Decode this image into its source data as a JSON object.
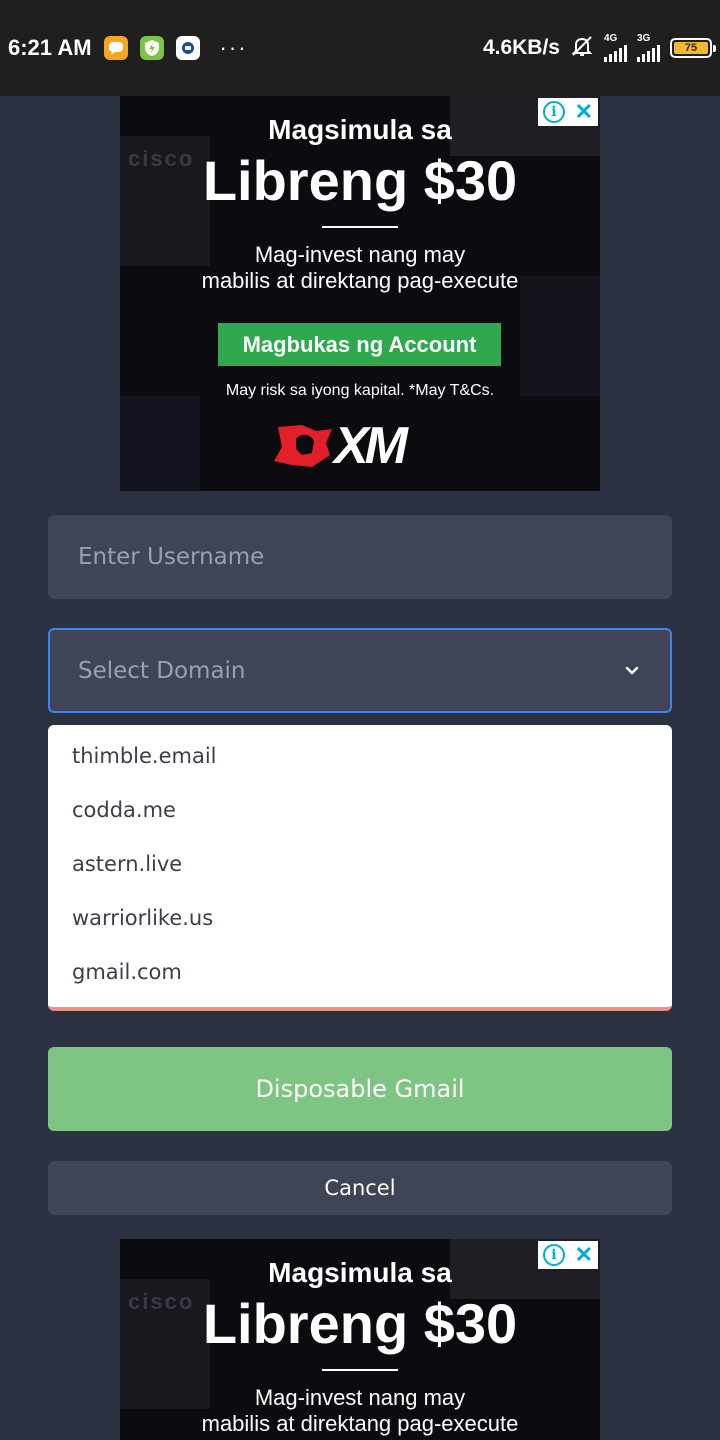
{
  "status_bar": {
    "time": "6:21 AM",
    "dots": "···",
    "net_speed": "4.6KB/s",
    "signal1_label": "4G",
    "signal2_label": "3G",
    "battery": "75",
    "icons": [
      "message-icon",
      "shield-icon",
      "payment-icon",
      "bell-muted-icon"
    ]
  },
  "ad_top": {
    "title_line1": "Magsimula sa",
    "title_line2": "Libreng $30",
    "sub_line1": "Mag-invest nang may",
    "sub_line2": "mabilis at direktang pag-execute",
    "cta": "Magbukas ng Account",
    "risk": "May risk sa iyong kapital. *May T&Cs.",
    "logo_text": "XM",
    "bg_text": "cisco"
  },
  "ad_bottom": {
    "title_line1": "Magsimula sa",
    "title_line2": "Libreng $30",
    "sub_line1": "Mag-invest nang may",
    "sub_line2": "mabilis at direktang pag-execute",
    "bg_text": "cisco"
  },
  "form": {
    "username_placeholder": "Enter Username",
    "domain_placeholder": "Select Domain",
    "domain_options": [
      "thimble.email",
      "codda.me",
      "astern.live",
      "warriorlike.us",
      "gmail.com"
    ],
    "submit_label": "Disposable Gmail",
    "cancel_label": "Cancel"
  },
  "colors": {
    "background": "#2c3241",
    "input_bg": "#3f4556",
    "focus_border": "#3b82f6",
    "primary_button": "#7ec482",
    "ad_cta": "#2fa84f"
  }
}
